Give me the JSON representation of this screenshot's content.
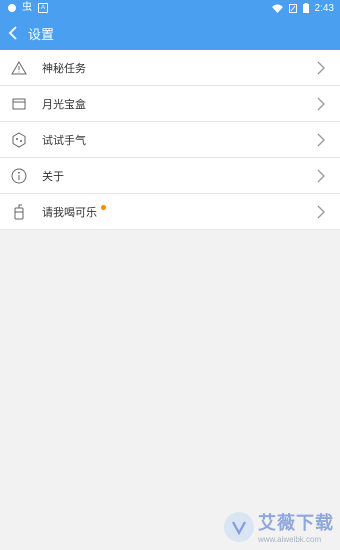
{
  "status_bar": {
    "time": "2:43",
    "icons": [
      "circle-notification-icon",
      "bug-icon",
      "a-badge-icon",
      "wifi-icon",
      "signal-icon",
      "battery-icon"
    ],
    "color": "#4a9ff0"
  },
  "header": {
    "title": "设置",
    "back_icon": "chevron-left-icon"
  },
  "settings": [
    {
      "label": "神秘任务",
      "icon": "warning-triangle-icon",
      "badge": false
    },
    {
      "label": "月光宝盒",
      "icon": "box-icon",
      "badge": false
    },
    {
      "label": "试试手气",
      "icon": "dice-icon",
      "badge": false
    },
    {
      "label": "关于",
      "icon": "info-icon",
      "badge": false
    },
    {
      "label": "请我喝可乐",
      "icon": "cup-icon",
      "badge": true,
      "badge_color": "#ff8a00"
    }
  ],
  "watermark": {
    "title": "艾薇下载",
    "url": "www.aiweibk.com"
  }
}
